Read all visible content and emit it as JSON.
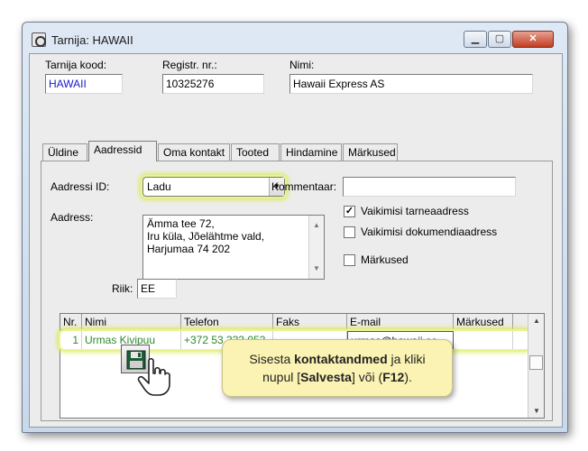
{
  "window": {
    "title": "Tarnija: HAWAII"
  },
  "header": {
    "code_label": "Tarnija kood:",
    "code_value": "HAWAII",
    "reg_label": "Registr. nr.:",
    "reg_value": "10325276",
    "name_label": "Nimi:",
    "name_value": "Hawaii Express AS"
  },
  "tabs": [
    "Üldine",
    "Aadressid",
    "Oma kontakt",
    "Tooted",
    "Hindamine",
    "Märkused"
  ],
  "address": {
    "id_label": "Aadressi ID:",
    "id_value": "Ladu",
    "comment_label": "Kommentaar:",
    "comment_value": "",
    "address_label": "Aadress:",
    "address_lines": [
      "Ämma tee 72,",
      "Iru küla, Jõelähtme vald,",
      "Harjumaa 74 202"
    ],
    "country_label": "Riik:",
    "country_value": "EE",
    "checkboxes": [
      {
        "label": "Vaikimisi tarneaadress",
        "checked": true
      },
      {
        "label": "Vaikimisi dokumendiaadress",
        "checked": false
      },
      {
        "label": "Märkused",
        "checked": false
      }
    ]
  },
  "contacts": {
    "columns": [
      "Nr.",
      "Nimi",
      "Telefon",
      "Faks",
      "E-mail",
      "Märkused"
    ],
    "rows": [
      {
        "nr": "1",
        "name": "Urmas Kivipuu",
        "phone": "+372 53 333 053",
        "fax": "",
        "email": "urmas@hawaii.ee",
        "notes": ""
      }
    ]
  },
  "callout": {
    "part1": "Sisesta ",
    "bold1": "kontaktandmed",
    "part2": " ja kliki",
    "part3": "nupul [",
    "bold2": "Salvesta",
    "part4": "] või (",
    "bold3": "F12",
    "part5": ")."
  },
  "icons": [
    "app-icon",
    "save-icon",
    "hand-cursor-icon",
    "checkmark-icon",
    "dropdown-arrow-icon"
  ]
}
